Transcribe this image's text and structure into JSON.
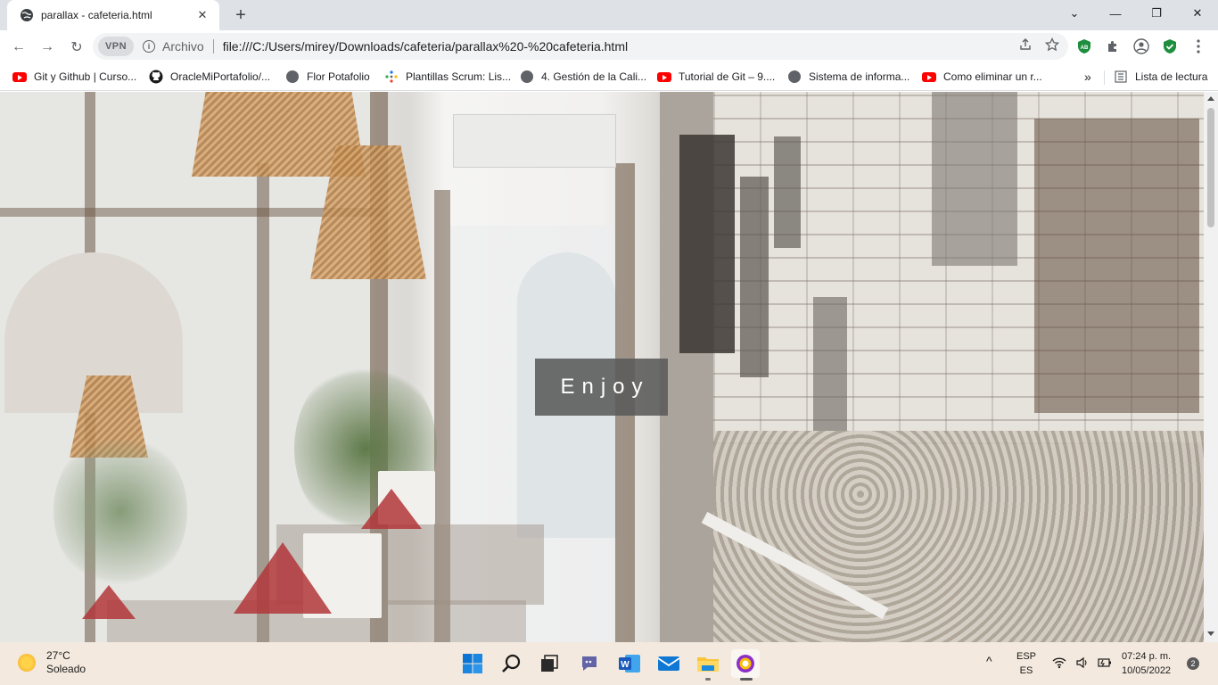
{
  "browser": {
    "tab": {
      "title": "parallax - cafeteria.html",
      "favicon": "globe-icon",
      "close_glyph": "✕"
    },
    "new_tab_glyph": "+",
    "window_controls": {
      "dropdown": "⌄",
      "minimize": "—",
      "restore": "❐",
      "close": "✕"
    },
    "toolbar": {
      "back": "←",
      "forward": "→",
      "reload": "↻",
      "vpn_label": "VPN",
      "site_label": "Archivo",
      "url": "file:///C:/Users/mirey/Downloads/cafeteria/parallax%20-%20cafeteria.html",
      "extensions": [
        "share-icon",
        "star-icon",
        "adblock-icon",
        "puzzle-icon",
        "profile-icon",
        "shield-check-icon",
        "menu-dots-icon"
      ]
    },
    "bookmarks": [
      {
        "label": "Git y Github | Curso...",
        "icon": "youtube-icon"
      },
      {
        "label": "OracleMiPortafolio/...",
        "icon": "github-icon"
      },
      {
        "label": "Flor Potafolio",
        "icon": "globe-icon"
      },
      {
        "label": "Plantillas Scrum: Lis...",
        "icon": "dots-icon"
      },
      {
        "label": "4. Gestión de la Cali...",
        "icon": "globe-icon"
      },
      {
        "label": "Tutorial de Git – 9....",
        "icon": "youtube-icon"
      },
      {
        "label": "Sistema de informa...",
        "icon": "globe-icon"
      },
      {
        "label": "Como eliminar un r...",
        "icon": "youtube-icon"
      }
    ],
    "bookmarks_overflow": "»",
    "reading_list": "Lista de lectura"
  },
  "page": {
    "hero_text": "Enjoy",
    "hero_image": "cafe-interior-photo"
  },
  "taskbar": {
    "weather": {
      "temp": "27°C",
      "condition": "Soleado",
      "icon": "sun-icon"
    },
    "apps": [
      "windows-start-icon",
      "search-icon",
      "task-view-icon",
      "chat-icon",
      "word-icon",
      "mail-icon",
      "file-explorer-icon",
      "browser-icon"
    ],
    "tray": {
      "chevron": "^",
      "lang_top": "ESP",
      "lang_bottom": "ES",
      "time": "07:24 p. m.",
      "date": "10/05/2022",
      "notifications": "2"
    }
  },
  "colors": {
    "tabstrip": "#dee1e6",
    "taskbar": "#f3e9de",
    "enjoy_box": "#5a5a5a"
  }
}
